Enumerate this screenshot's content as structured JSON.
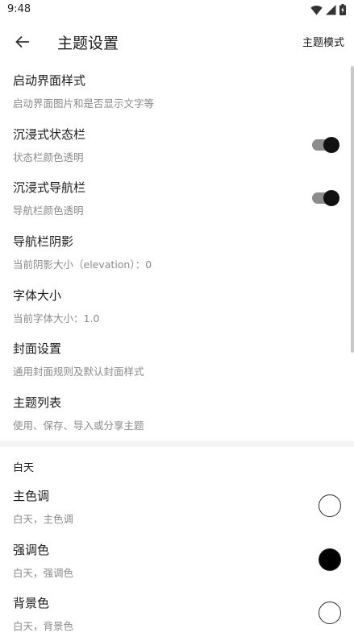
{
  "status_bar": {
    "time": "9:48",
    "icons": [
      "wifi-icon",
      "signal-icon",
      "battery-icon"
    ]
  },
  "app_bar": {
    "back_icon": "arrow-left-icon",
    "title": "主题设置",
    "theme_mode_label": "主题模式"
  },
  "settings": [
    {
      "title": "启动界面样式",
      "subtitle": "启动界面图片和是否显示文字等",
      "has_switch": false
    },
    {
      "title": "沉浸式状态栏",
      "subtitle": "状态栏颜色透明",
      "has_switch": true,
      "switch_on": true
    },
    {
      "title": "沉浸式导航栏",
      "subtitle": "导航栏颜色透明",
      "has_switch": true,
      "switch_on": true
    },
    {
      "title": "导航栏阴影",
      "subtitle": "当前阴影大小（elevation）：0",
      "has_switch": false
    },
    {
      "title": "字体大小",
      "subtitle": "当前字体大小：1.0",
      "has_switch": false
    },
    {
      "title": "封面设置",
      "subtitle": "通用封面规则及默认封面样式",
      "has_switch": false
    },
    {
      "title": "主题列表",
      "subtitle": "使用、保存、导入或分享主题",
      "has_switch": false
    }
  ],
  "day_section": {
    "header": "白天",
    "items": [
      {
        "title": "主色调",
        "subtitle": "白天，主色调",
        "color": "#ffffff"
      },
      {
        "title": "强调色",
        "subtitle": "白天，强调色",
        "color": "#000000"
      },
      {
        "title": "背景色",
        "subtitle": "白天，背景色",
        "color": "#ffffff"
      }
    ]
  }
}
